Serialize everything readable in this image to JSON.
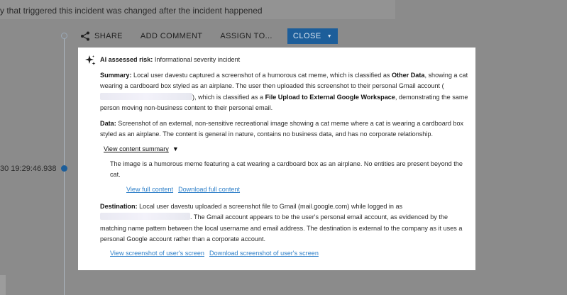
{
  "notice": "y that triggered this incident was changed after the incident happened",
  "timeline": {
    "timestamp": "30 19:29:46.938"
  },
  "toolbar": {
    "share": "SHARE",
    "add_comment": "ADD COMMENT",
    "assign_to": "ASSIGN TO...",
    "close": "CLOSE"
  },
  "panel": {
    "risk_label": "AI assessed risk:",
    "risk_value": "Informational severity incident",
    "summary": {
      "label": "Summary:",
      "text_1": "Local user davestu captured a screenshot of a humorous cat meme, which is classified as",
      "class_1": "Other Data",
      "text_2": ", showing a cat wearing a cardboard box styled as an airplane. The user then uploaded this screenshot to their personal Gmail account (",
      "text_3": "), which is classified as a",
      "class_2": "File Upload to External Google Workspace",
      "text_4": ", demonstrating the same person moving non-business content to their personal email."
    },
    "data": {
      "label": "Data:",
      "text": "Screenshot of an external, non-sensitive recreational image showing a cat meme where a cat is wearing a cardboard box styled as an airplane. The content is general in nature, contains no business data, and has no corporate relationship."
    },
    "content_summary": {
      "toggle_label": "View content summary",
      "body": "The image is a humorous meme featuring a cat wearing a cardboard box as an airplane. No entities are present beyond the cat.",
      "view_full": "View full content",
      "download_full": "Download full content"
    },
    "destination": {
      "label": "Destination:",
      "text_1": "Local user davestu uploaded a screenshot file to Gmail (mail.google.com) while logged in as",
      "text_2": ". The Gmail account appears to be the user's personal email account, as evidenced by the matching name pattern between the local username and email address. The destination is external to the company as it uses a personal Google account rather than a corporate account.",
      "view_screenshot": "View screenshot of user's screen",
      "download_screenshot": "Download screenshot of user's screen"
    }
  }
}
